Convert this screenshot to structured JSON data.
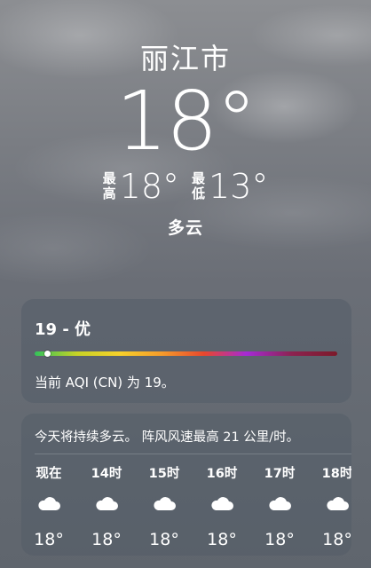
{
  "header": {
    "city": "丽江市",
    "temperature": "18°",
    "high_label_top": "最",
    "high_label_bottom": "高",
    "high_value": "18°",
    "low_label_top": "最",
    "low_label_bottom": "低",
    "low_value": "13°",
    "condition": "多云"
  },
  "aqi": {
    "title": "19 - 优",
    "description": "当前 AQI (CN) 为 19。",
    "value": 19,
    "scale_colors": [
      "#33c35a",
      "#c7d326",
      "#f7d12a",
      "#f59b2b",
      "#e8472c",
      "#a52ad6",
      "#8c2350",
      "#7c1a2a"
    ]
  },
  "forecast": {
    "summary": "今天将持续多云。 阵风风速最高 21 公里/时。",
    "hours": [
      {
        "label": "现在",
        "icon": "cloud-icon",
        "temp": "18°"
      },
      {
        "label": "14时",
        "icon": "cloud-icon",
        "temp": "18°"
      },
      {
        "label": "15时",
        "icon": "cloud-icon",
        "temp": "18°"
      },
      {
        "label": "16时",
        "icon": "cloud-icon",
        "temp": "18°"
      },
      {
        "label": "17时",
        "icon": "cloud-icon",
        "temp": "18°"
      },
      {
        "label": "18时",
        "icon": "cloud-icon",
        "temp": "18°"
      }
    ]
  }
}
